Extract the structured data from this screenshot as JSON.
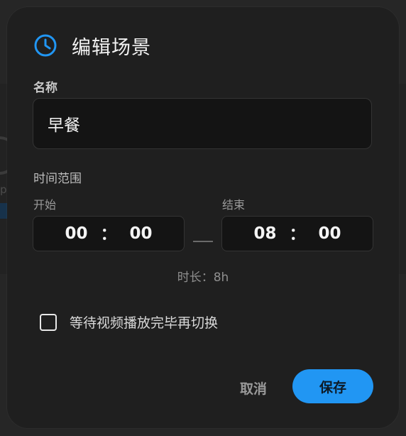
{
  "dialog": {
    "title": "编辑场景",
    "icon": "clock-icon",
    "accent_color": "#2196f3"
  },
  "name_field": {
    "label": "名称",
    "value": "早餐"
  },
  "time_range": {
    "label": "时间范围",
    "start": {
      "label": "开始",
      "hour": "00",
      "minute": "00"
    },
    "end": {
      "label": "结束",
      "hour": "08",
      "minute": "00"
    },
    "separator": "：",
    "duration_text": "时长：8h"
  },
  "wait_option": {
    "label": "等待视频播放完毕再切换",
    "checked": false
  },
  "actions": {
    "cancel_label": "取消",
    "save_label": "保存"
  }
}
